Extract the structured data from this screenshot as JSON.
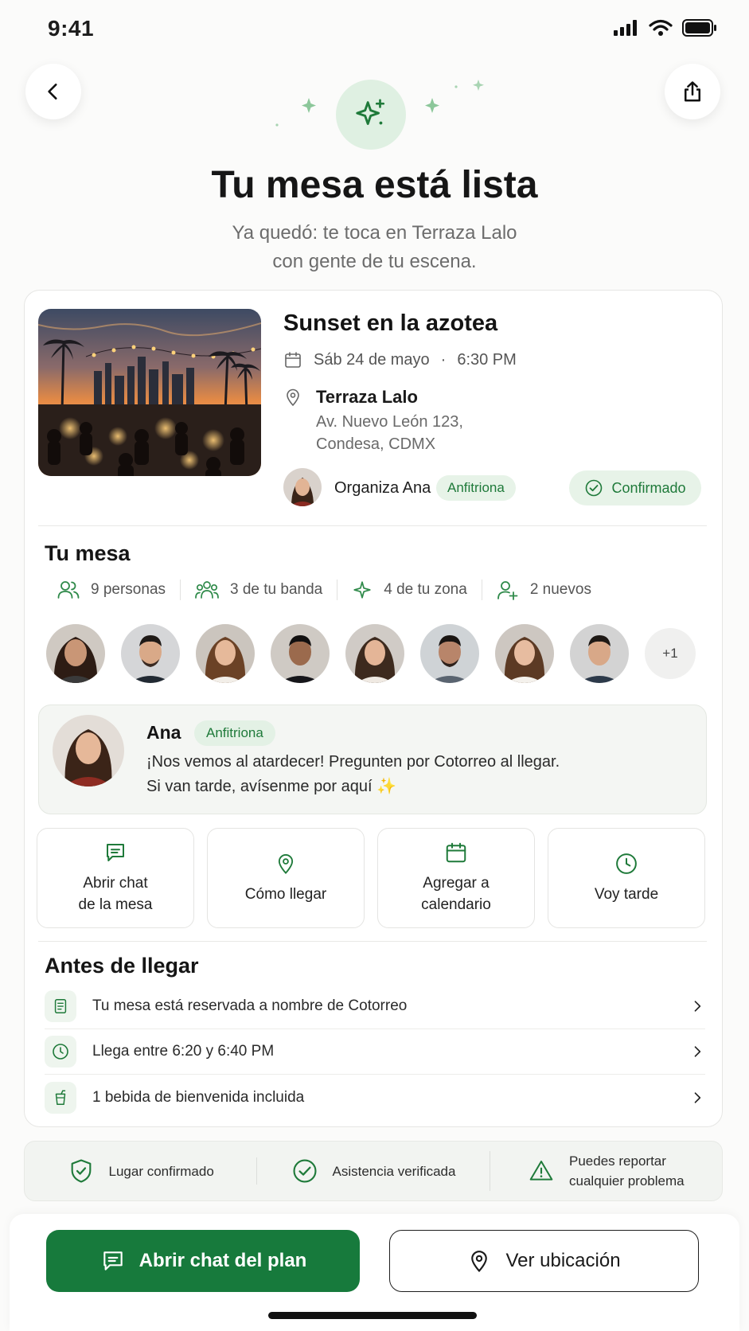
{
  "status_bar": {
    "time": "9:41"
  },
  "header": {
    "title": "Tu mesa está lista",
    "subtitle_line1": "Ya quedó: te toca en Terraza Lalo",
    "subtitle_line2": "con gente de tu escena."
  },
  "event": {
    "title": "Sunset en la azotea",
    "date": "Sáb 24 de mayo",
    "separator": "·",
    "time": "6:30 PM",
    "place_name": "Terraza Lalo",
    "address_line1": "Av. Nuevo León 123,",
    "address_line2": "Condesa, CDMX",
    "organizer": "Organiza Ana",
    "host_badge": "Anfitriona",
    "status": "Confirmado"
  },
  "table": {
    "title": "Tu mesa",
    "stats": [
      {
        "label": "9 personas",
        "icon": "people-icon"
      },
      {
        "label": "3 de tu banda",
        "icon": "group-icon"
      },
      {
        "label": "4 de tu zona",
        "icon": "sparkle-icon"
      },
      {
        "label": "2 nuevos",
        "icon": "user-plus-icon"
      }
    ],
    "more_count": "+1"
  },
  "host_message": {
    "name": "Ana",
    "badge": "Anfitriona",
    "line1": "¡Nos vemos al atardecer! Pregunten por Cotorreo al llegar.",
    "line2": "Si van tarde, avísenme por aquí ✨"
  },
  "actions": [
    {
      "line1": "Abrir chat",
      "line2": "de la mesa",
      "icon": "chat-icon"
    },
    {
      "line1": "Cómo llegar",
      "line2": "",
      "icon": "location-pin-icon"
    },
    {
      "line1": "Agregar a",
      "line2": "calendario",
      "icon": "calendar-icon"
    },
    {
      "line1": "Voy tarde",
      "line2": "",
      "icon": "clock-icon"
    }
  ],
  "before": {
    "title": "Antes de llegar",
    "items": [
      {
        "label": "Tu mesa está reservada a nombre de Cotorreo",
        "icon": "document-icon"
      },
      {
        "label": "Llega entre 6:20 y 6:40 PM",
        "icon": "clock-icon"
      },
      {
        "label": "1 bebida de bienvenida incluida",
        "icon": "drink-icon"
      }
    ]
  },
  "trust": [
    {
      "line1": "Lugar confirmado",
      "line2": "",
      "icon": "shield-check-icon"
    },
    {
      "line1": "Asistencia verificada",
      "line2": "",
      "icon": "check-circle-icon"
    },
    {
      "line1": "Puedes reportar",
      "line2": "cualquier problema",
      "icon": "warning-icon"
    }
  ],
  "footer": {
    "primary": "Abrir chat del plan",
    "secondary": "Ver ubicación"
  },
  "colors": {
    "accent": "#177a3c",
    "accent_light": "#e7f3e8",
    "text": "#1c1c1c"
  }
}
